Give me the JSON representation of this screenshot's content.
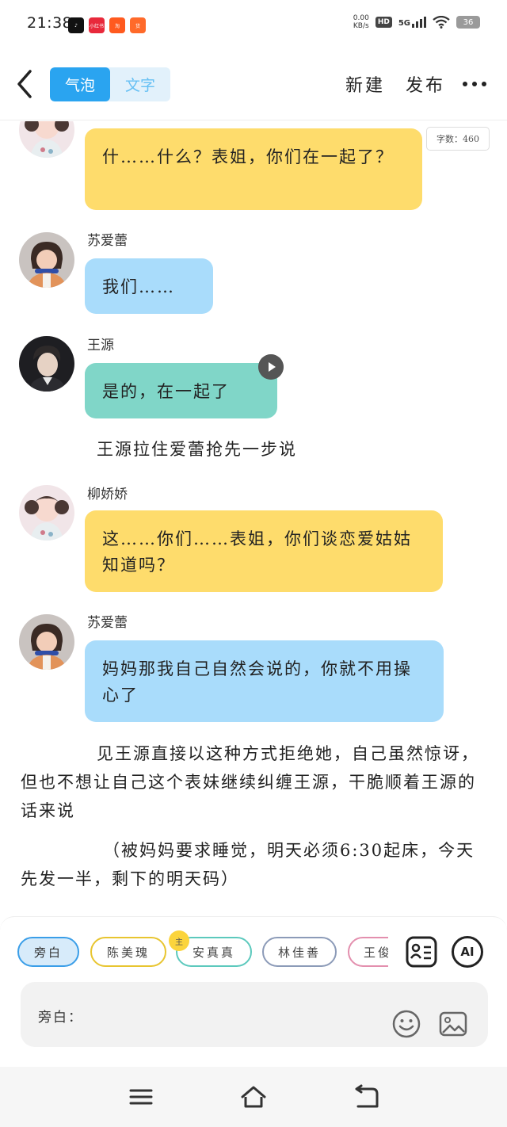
{
  "status_bar": {
    "time": "21:38",
    "app_icons": [
      {
        "name": "tiktok-icon",
        "color": "#111111",
        "label": "♪"
      },
      {
        "name": "xiaohongshu-icon",
        "color": "#e8293b",
        "label": "小红书"
      },
      {
        "name": "taobao-deals-icon",
        "color": "#ff5a1f",
        "label": "淘"
      },
      {
        "name": "shop-icon",
        "color": "#ff6a2a",
        "label": "货"
      }
    ],
    "net_speed_value": "0.00",
    "net_speed_unit": "KB/s",
    "hd": "HD",
    "signal": "5G",
    "battery": "36"
  },
  "top_bar": {
    "tab_bubble": "气泡",
    "tab_text": "文字",
    "new_label": "新建",
    "publish_label": "发布",
    "accent_color": "#2aa4f0"
  },
  "chat": {
    "word_count": "字数：460",
    "messages": [
      {
        "sender": "",
        "text": "什……什么？表姐，你们在一起了？",
        "color": "yellow"
      },
      {
        "sender": "苏爱蕾",
        "text": "我们……",
        "color": "blue"
      },
      {
        "sender": "王源",
        "text": "是的，在一起了",
        "color": "green"
      },
      {
        "sender": "柳娇娇",
        "text": "这……你们……表姐，你们谈恋爱姑姑知道吗？",
        "color": "yellow"
      },
      {
        "sender": "苏爱蕾",
        "text": "妈妈那我自己自然会说的，你就不用操心了",
        "color": "blue"
      }
    ],
    "narrations": [
      "王源拉住爱蕾抢先一步说",
      "见王源直接以这种方式拒绝她，自己虽然惊讶，但也不想让自己这个表妹继续纠缠王源，干脆顺着王源的话来说",
      "（被妈妈要求睡觉，明天必须6:30起床，今天先发一半，剩下的明天码）"
    ]
  },
  "bottom": {
    "chips": [
      "旁白",
      "陈美瑰",
      "安真真",
      "林佳善",
      "王俊"
    ],
    "main_badge": "主",
    "ai_label": "AI",
    "input_label": "旁白："
  }
}
